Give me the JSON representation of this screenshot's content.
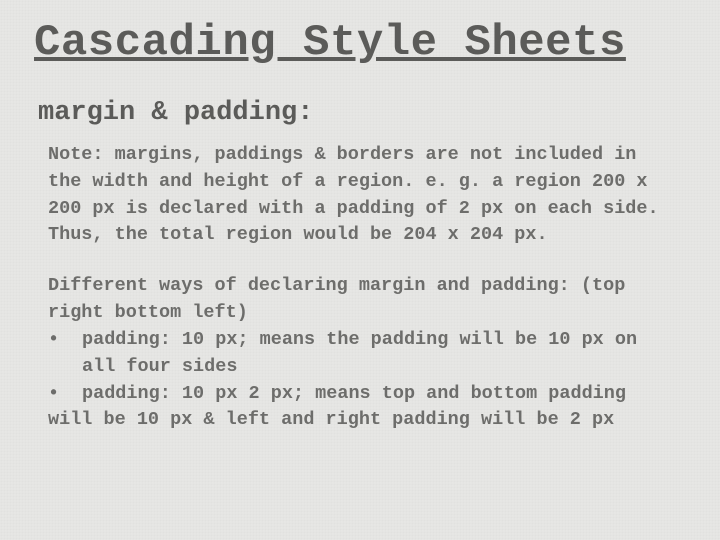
{
  "title": "Cascading Style Sheets",
  "subtitle": "margin & padding:",
  "note": "Note: margins, paddings & borders are not included in the width and height of a region. e. g. a region 200 x 200 px is declared with a padding of 2 px on each side. Thus, the total region would be 204 x 204 px.",
  "ways_intro": "Different ways of declaring margin and padding: (top right bottom left)",
  "bullet_mark": "•",
  "bullets": [
    "padding: 10 px; means the padding will be 10 px on all four sides",
    "padding: 10 px 2 px; means top and bottom padding"
  ],
  "bullet_cont": "will be 10 px & left and right padding will be 2 px"
}
